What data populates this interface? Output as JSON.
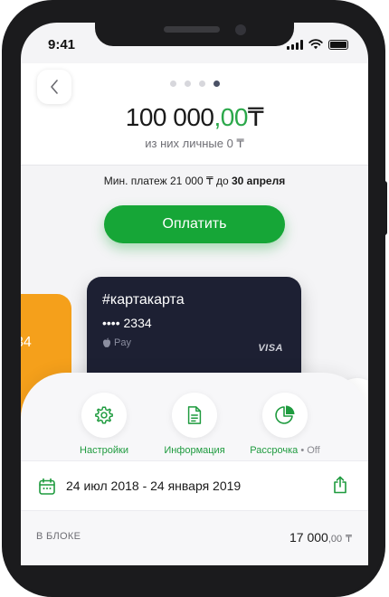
{
  "status_bar": {
    "time": "9:41"
  },
  "pager": {
    "pages": 4,
    "active": 3
  },
  "balance": {
    "integer": "100 000",
    "decimals": ",00",
    "currency": "₸",
    "sub": "из них личные 0 ₸"
  },
  "payment": {
    "prefix": "Мин. платеж 21 000 ₸ до",
    "date": "30 апреля",
    "button_label": "Оплатить"
  },
  "cards": {
    "orange": {
      "partial_text": "34"
    },
    "dark": {
      "name": "#картакарта",
      "number": "•••• 2334",
      "pay_label": "Pay",
      "network": "VISA"
    }
  },
  "actions": [
    {
      "label": "Настройки",
      "icon": "gear-icon"
    },
    {
      "label": "Информация",
      "icon": "document-icon"
    },
    {
      "label": "Рассрочка",
      "status": "• Off",
      "icon": "pie-chart-icon"
    }
  ],
  "period": {
    "text": "24 июл 2018 - 24 января 2019"
  },
  "block": {
    "label": "В БЛОКЕ",
    "amount": "17 000",
    "decimals": ",00",
    "currency": "₸"
  },
  "colors": {
    "accent": "#16a637",
    "card_dark": "#1d2033",
    "card_orange": "#f5a01b"
  }
}
